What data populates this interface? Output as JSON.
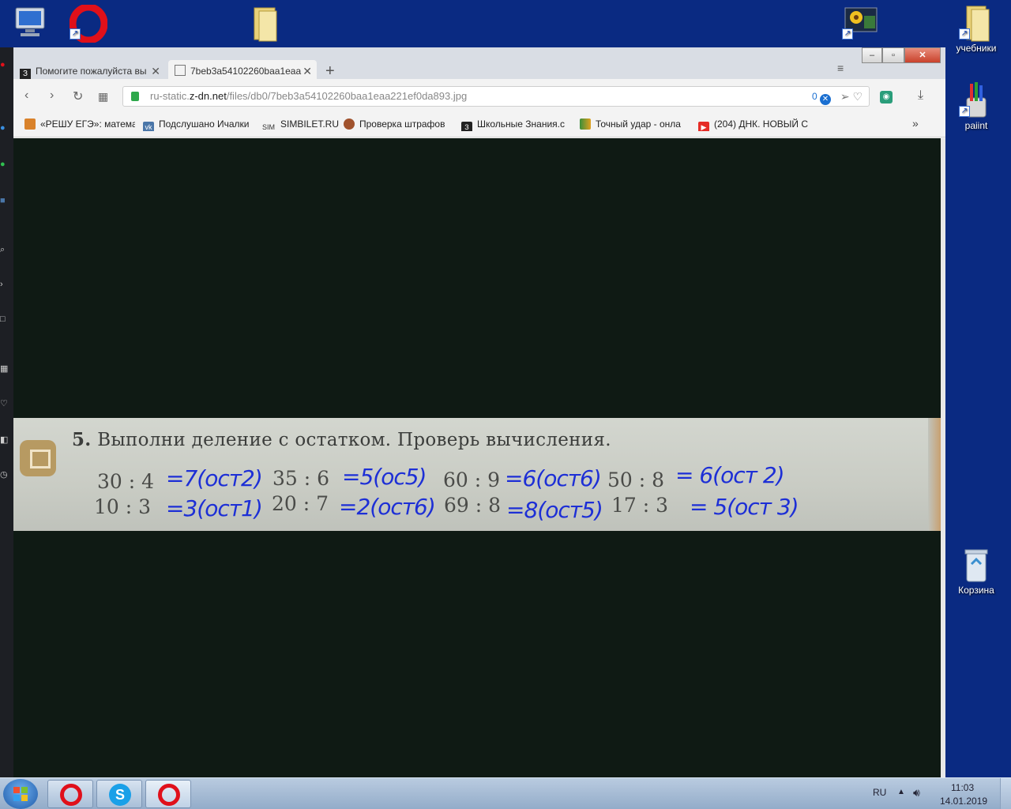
{
  "desktop": {
    "icons": [
      {
        "name": "computer",
        "label": ""
      },
      {
        "name": "opera",
        "label": ""
      },
      {
        "name": "folder",
        "label": ""
      },
      {
        "name": "picture-shortcut",
        "label": ""
      },
      {
        "name": "uchebniki",
        "label": "учебники"
      },
      {
        "name": "paint",
        "label": "paiint"
      },
      {
        "name": "recycle-bin",
        "label": "Корзина"
      }
    ]
  },
  "browser": {
    "tabs": [
      {
        "label": "Помогите пожалуйста вы",
        "favicon": "З",
        "active": false
      },
      {
        "label": "7beb3a54102260baa1eaa",
        "favicon": "",
        "active": true
      }
    ],
    "new_tab": "+",
    "url": {
      "prefix": "ru-static.",
      "host": "z-dn.net",
      "path": "/files/db0/7beb3a54102260baa1eaa221ef0da893.jpg"
    },
    "adblock_count": "0",
    "bookmarks": [
      {
        "label": "«РЕШУ ЕГЭ»: матема",
        "color": "#d9822b",
        "icon": ""
      },
      {
        "label": "Подслушано Ичалки",
        "color": "#4a76a8",
        "icon": "vk"
      },
      {
        "label": "SIMBILET.RU",
        "color": "#555555",
        "icon": "SIM"
      },
      {
        "label": "Проверка штрафов",
        "color": "#a0522d",
        "icon": ""
      },
      {
        "label": "Школьные Знания.с",
        "color": "#222222",
        "icon": "З"
      },
      {
        "label": "Точный удар - онла",
        "color": "#3a8f3a",
        "icon": ""
      },
      {
        "label": "(204) ДНК. НОВЫЙ С",
        "color": "#e52d27",
        "icon": ""
      }
    ],
    "bookmarks_more": "»"
  },
  "worksheet": {
    "title_number": "5.",
    "title": "Выполни деление с остатком. Проверь вычисления.",
    "rows": [
      [
        {
          "expr": "30 : 4",
          "answer": "=7(ост2)"
        },
        {
          "expr": "35 : 6",
          "answer": "=5(ос5)"
        },
        {
          "expr": "60 : 9",
          "answer": "=6(ост6)"
        },
        {
          "expr": "50 : 8",
          "answer": "= 6(ост 2)"
        }
      ],
      [
        {
          "expr": "10 : 3",
          "answer": "=3(ост1)"
        },
        {
          "expr": "20 : 7",
          "answer": "=2(ост6)"
        },
        {
          "expr": "69 : 8",
          "answer": "=8(ост5)"
        },
        {
          "expr": "17 : 3",
          "answer": "= 5(ост 3)"
        }
      ]
    ]
  },
  "taskbar": {
    "lang": "RU",
    "time": "11:03",
    "date": "14.01.2019"
  }
}
